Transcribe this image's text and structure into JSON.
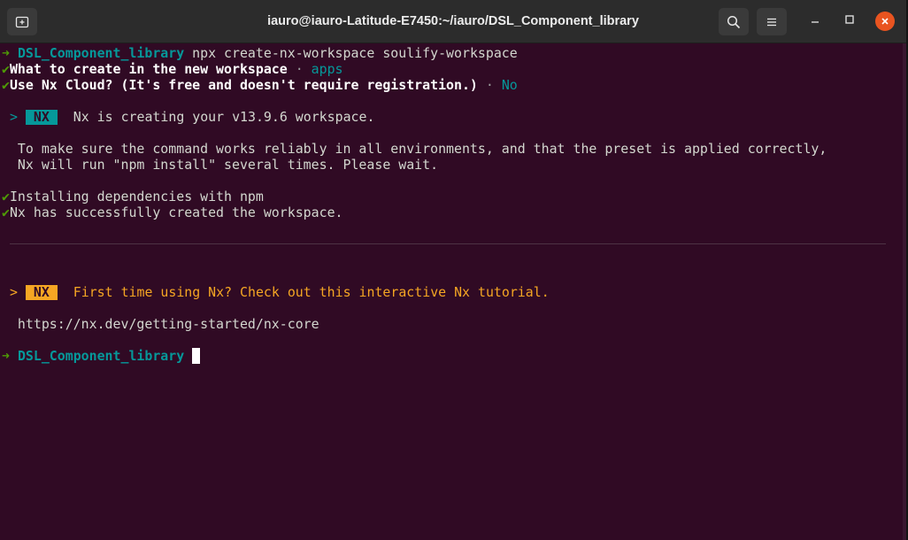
{
  "window": {
    "title": "iauro@iauro-Latitude-E7450:~/iauro/DSL_Component_library"
  },
  "titlebar": {
    "new_tab_icon": "new-tab-icon",
    "search_icon": "search-icon",
    "menu_icon": "hamburger-menu-icon",
    "minimize_icon": "minimize-icon",
    "maximize_icon": "maximize-icon",
    "close_icon": "close-icon"
  },
  "colors": {
    "background": "#300a24",
    "prompt_green": "#4e9a06",
    "cyan": "#06989a",
    "orange": "#f5a623",
    "close_button": "#e95420"
  },
  "terminal": {
    "line1": {
      "arrow": "➜",
      "dir": "DSL_Component_library",
      "cmd": " npx create-nx-workspace soulify-workspace"
    },
    "line2": {
      "check": "✔",
      "question": "What to create in the new workspace",
      "sep": " · ",
      "answer": "apps"
    },
    "line3": {
      "check": "✔",
      "question": "Use Nx Cloud? (It's free and doesn't require registration.)",
      "sep": " · ",
      "answer": "No"
    },
    "line4": {
      "prefix": " > ",
      "badge": "NX",
      "text": "  Nx is creating your v13.9.6 workspace."
    },
    "line5": "  To make sure the command works reliably in all environments, and that the preset is applied correctly,",
    "line6": "  Nx will run \"npm install\" several times. Please wait.",
    "line7": {
      "check": "✔",
      "text": "Installing dependencies with npm"
    },
    "line8": {
      "check": "✔",
      "text": "Nx has successfully created the workspace."
    },
    "line9": {
      "prefix": " > ",
      "badge": "NX",
      "text": "  First time using Nx? Check out this interactive Nx tutorial."
    },
    "line10": "  https://nx.dev/getting-started/nx-core",
    "line11": {
      "arrow": "➜",
      "dir": "DSL_Component_library"
    }
  }
}
